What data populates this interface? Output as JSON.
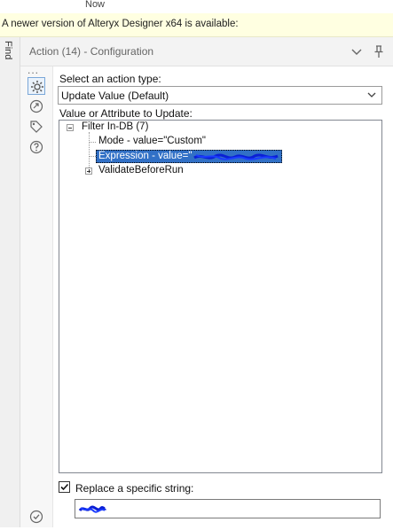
{
  "top": {
    "now_label": "Now"
  },
  "banner": {
    "text": "A newer version of Alteryx Designer x64 is available:"
  },
  "find_tab": {
    "label": "Find"
  },
  "panel": {
    "title": "Action (14) - Configuration",
    "collapse_icon": "chevron-down-icon",
    "pin_icon": "pin-icon"
  },
  "sidebar": {
    "more": "...",
    "icons": [
      "gear-icon",
      "connection-icon",
      "tag-icon",
      "help-icon"
    ],
    "bottom_icon": "check-circle-icon"
  },
  "action_type": {
    "label": "Select an action type:",
    "selected": "Update Value (Default)"
  },
  "tree": {
    "label": "Value or Attribute to Update:",
    "root": "Filter In-DB (7)",
    "items": [
      {
        "text": "Mode - value=\"Custom\""
      },
      {
        "text": "Expression - value=\"",
        "selected": true,
        "redacted": true
      },
      {
        "text": "ValidateBeforeRun",
        "expandable": true
      }
    ]
  },
  "replace": {
    "checked": true,
    "label": "Replace a specific string:",
    "value_redacted": true
  },
  "colors": {
    "banner_bg": "#ffffe1",
    "selection": "#3170c6",
    "accent": "#7aa7d8"
  }
}
